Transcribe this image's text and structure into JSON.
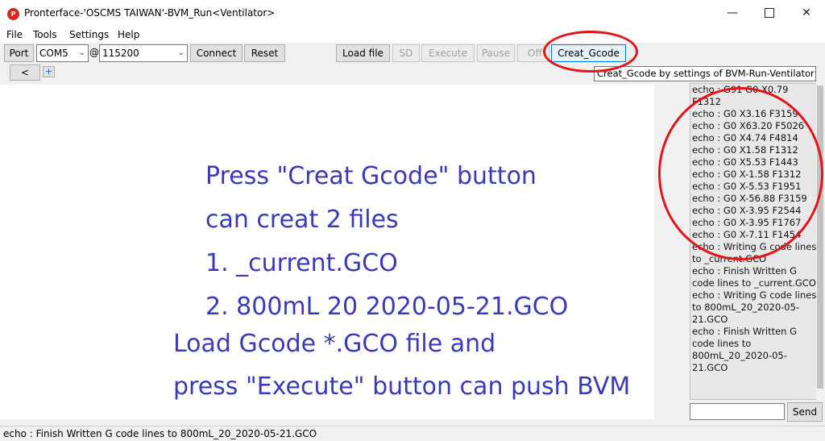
{
  "window": {
    "title": "Pronterface-'OSCMS TAIWAN'-BVM_Run<Ventilator>",
    "icon_text": "P"
  },
  "window_controls": {
    "minimize": "—",
    "close": "✕"
  },
  "menu": [
    "File",
    "Tools",
    "Settings",
    "Help"
  ],
  "toolbar": {
    "port_label": "Port",
    "port_value": "COM5",
    "at_sign": "@",
    "baud_value": "115200",
    "connect_label": "Connect",
    "reset_label": "Reset",
    "load_file_label": "Load file",
    "sd_label": "SD",
    "execute_label": "Execute",
    "pause_label": "Pause",
    "off_label": "Off",
    "creat_gcode_label": "Creat_Gcode",
    "back_label": "<",
    "plus_label": "+"
  },
  "tooltip": "Creat_Gcode by settings of BVM-Run-Ventilator",
  "overlay": {
    "line1": "Press \"Creat Gcode\" button",
    "line2": "can creat 2 files",
    "line3": "1. _current.GCO",
    "line4": "2. 800mL  20  2020-05-21.GCO",
    "line5": "Load Gcode *.GCO file and",
    "line6": "press \"Execute\" button can push BVM"
  },
  "console": [
    "echo : G91 G0 X0.79 F1312",
    "echo : G0 X3.16 F3159",
    "echo : G0 X63.20 F5026",
    "echo : G0 X4.74 F4814",
    "echo : G0 X1.58 F1312",
    "echo : G0 X5.53 F1443",
    "echo : G0 X-1.58 F1312",
    "echo : G0 X-5.53 F1951",
    "echo : G0 X-56.88 F3159",
    "echo : G0 X-3.95 F2544",
    "echo : G0 X-3.95 F1767",
    "echo : G0 X-7.11 F1454",
    "echo : Writing G code lines to _current.GCO",
    "echo : Finish Written G code lines to _current.GCO",
    "echo : Writing G code lines to 800mL_20_2020-05-21.GCO",
    "echo : Finish Written G code lines to 800mL_20_2020-05-21.GCO"
  ],
  "command_input": {
    "value": ""
  },
  "send_label": "Send",
  "status_text": "echo : Finish Written G code lines to 800mL_20_2020-05-21.GCO",
  "colors": {
    "annotation_text": "#3a3ab8",
    "highlight_ring": "#e3141b"
  }
}
